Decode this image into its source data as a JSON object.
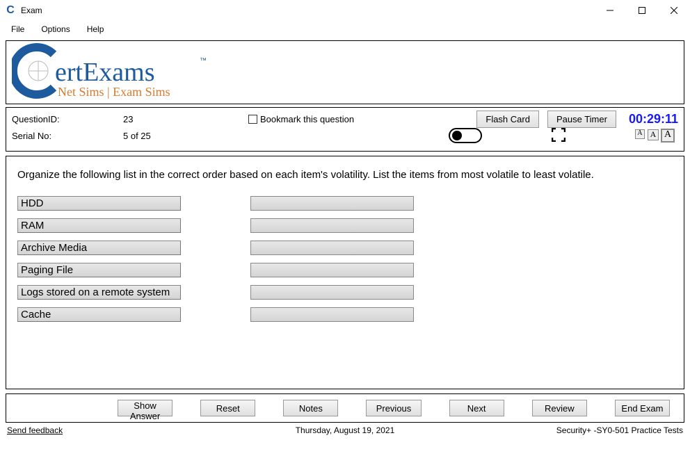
{
  "window": {
    "title": "Exam"
  },
  "menu": {
    "file": "File",
    "options": "Options",
    "help": "Help"
  },
  "logo": {
    "brand_top": "ertExams",
    "brand_sub": "Net Sims | Exam Sims"
  },
  "info": {
    "question_id_label": "QuestionID:",
    "question_id": "23",
    "serial_label": "Serial No:",
    "serial": "5 of 25",
    "bookmark_label": "Bookmark this question",
    "flash_card": "Flash Card",
    "pause_timer": "Pause Timer",
    "timer": "00:29:11"
  },
  "question": {
    "text": "Organize the following list in the correct order based on each item's volatility. List the items from most volatile to least volatile.",
    "items": [
      "HDD",
      "RAM",
      "Archive Media",
      "Paging File",
      "Logs stored on a remote system",
      "Cache"
    ]
  },
  "buttons": {
    "show_answer": "Show Answer",
    "reset": "Reset",
    "notes": "Notes",
    "previous": "Previous",
    "next": "Next",
    "review": "Review",
    "end_exam": "End Exam"
  },
  "status": {
    "feedback": "Send feedback",
    "date": "Thursday, August 19, 2021",
    "exam_name": "Security+ -SY0-501 Practice Tests"
  }
}
